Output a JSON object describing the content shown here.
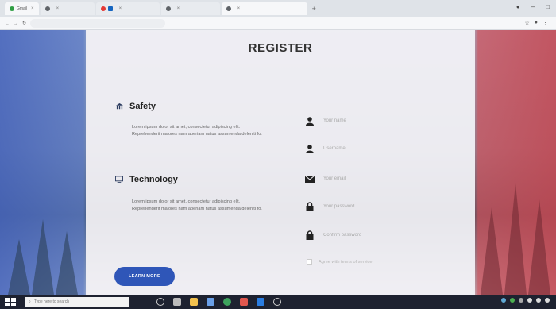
{
  "browser": {
    "tabs": [
      {
        "label": "Gmail",
        "color": "#2f9e44"
      },
      {
        "label": "",
        "color": "#5f6368"
      },
      {
        "label": "",
        "color": "#e53935"
      },
      {
        "label": "",
        "color": "#1565c0"
      },
      {
        "label": "",
        "color": "#5f6368"
      }
    ],
    "url": ""
  },
  "page": {
    "title": "REGISTER",
    "features": [
      {
        "icon": "bank-icon",
        "title": "Safety",
        "description": "Lorem ipsum dolor sit amet, consectetur adipiscing elit. Reprehenderit maiores nam aperiam natus assumenda deleniti fo."
      },
      {
        "icon": "desktop-icon",
        "title": "Technology",
        "description": "Lorem ipsum dolor sit amet, consectetur adipiscing elit. Reprehenderit maiores nam aperiam natus assumenda deleniti fo."
      }
    ],
    "learn_more_label": "LEARN MORE",
    "fields": [
      {
        "icon": "user-icon",
        "placeholder": "Your name"
      },
      {
        "icon": "user-icon",
        "placeholder": "Username"
      },
      {
        "icon": "envelope-icon",
        "placeholder": "Your email"
      },
      {
        "icon": "lock-icon",
        "placeholder": "Your password"
      },
      {
        "icon": "lock-icon",
        "placeholder": "Confirm password"
      }
    ],
    "terms_label": "Agree with terms of service",
    "accent_color": "#2f56b8"
  },
  "taskbar": {
    "search_placeholder": "Type here to search"
  }
}
